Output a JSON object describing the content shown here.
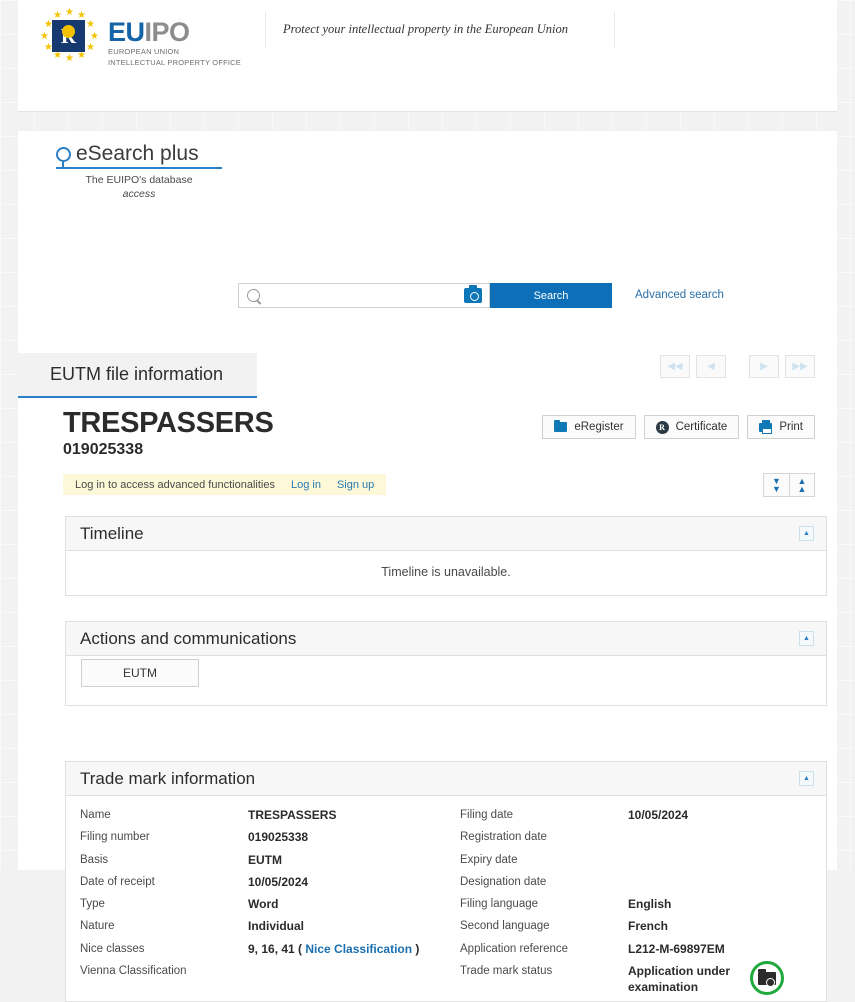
{
  "header": {
    "logo_letter": "R",
    "logo_eu": "EU",
    "logo_ipo": "IPO",
    "logo_sub_line1": "EUROPEAN UNION",
    "logo_sub_line2": "INTELLECTUAL PROPERTY OFFICE",
    "tagline": "Protect your intellectual property in the European Union"
  },
  "search": {
    "brand_title": "eSearch plus",
    "brand_sub": "The EUIPO's database",
    "brand_sub_access": "access",
    "placeholder": "",
    "value": "",
    "search_button": "Search",
    "advanced_search": "Advanced search"
  },
  "pager": {
    "first": "◀◀",
    "prev": "◀",
    "next": "▶",
    "last": "▶▶"
  },
  "tab": {
    "label": "EUTM file information"
  },
  "record": {
    "title": "TRESPASSERS",
    "number": "019025338"
  },
  "actions": {
    "eregister": "eRegister",
    "certificate": "Certificate",
    "certificate_icon_letter": "R",
    "print": "Print"
  },
  "login_banner": {
    "message": "Log in to access advanced functionalities",
    "login": "Log in",
    "signup": "Sign up"
  },
  "expand_controls": {
    "expand_all": "▼",
    "collapse_all": "▲"
  },
  "sections": {
    "timeline": {
      "title": "Timeline",
      "message": "Timeline is unavailable.",
      "collapse": "▲"
    },
    "actions_comm": {
      "title": "Actions and communications",
      "eutm_button": "EUTM",
      "collapse": "▲"
    },
    "tm_info": {
      "title": "Trade mark information",
      "collapse": "▲",
      "left_rows": [
        {
          "label": "Name",
          "value": "TRESPASSERS"
        },
        {
          "label": "Filing number",
          "value": "019025338"
        },
        {
          "label": "Basis",
          "value": "EUTM"
        },
        {
          "label": "Date of receipt",
          "value": "10/05/2024"
        },
        {
          "label": "Type",
          "value": "Word"
        },
        {
          "label": "Nature",
          "value": "Individual"
        },
        {
          "label": "Nice classes",
          "value": "9, 16, 41 (",
          "link": "Nice Classification",
          "value_after": ")"
        },
        {
          "label": "Vienna Classification",
          "value": ""
        }
      ],
      "right_rows": [
        {
          "label": "Filing date",
          "value": "10/05/2024"
        },
        {
          "label": "Registration date",
          "value": ""
        },
        {
          "label": "Expiry date",
          "value": ""
        },
        {
          "label": "Designation date",
          "value": ""
        },
        {
          "label": "Filing language",
          "value": "English"
        },
        {
          "label": "Second language",
          "value": "French"
        },
        {
          "label": "Application reference",
          "value": "L212-M-69897EM"
        },
        {
          "label": "Trade mark status",
          "value": "Application under examination"
        }
      ]
    }
  },
  "colors": {
    "brand_blue": "#0d6fb8",
    "logo_navy": "#16396f",
    "star_gold": "#f3c200",
    "status_green": "#1fa93c",
    "banner_yellow": "#fcf8d8"
  }
}
